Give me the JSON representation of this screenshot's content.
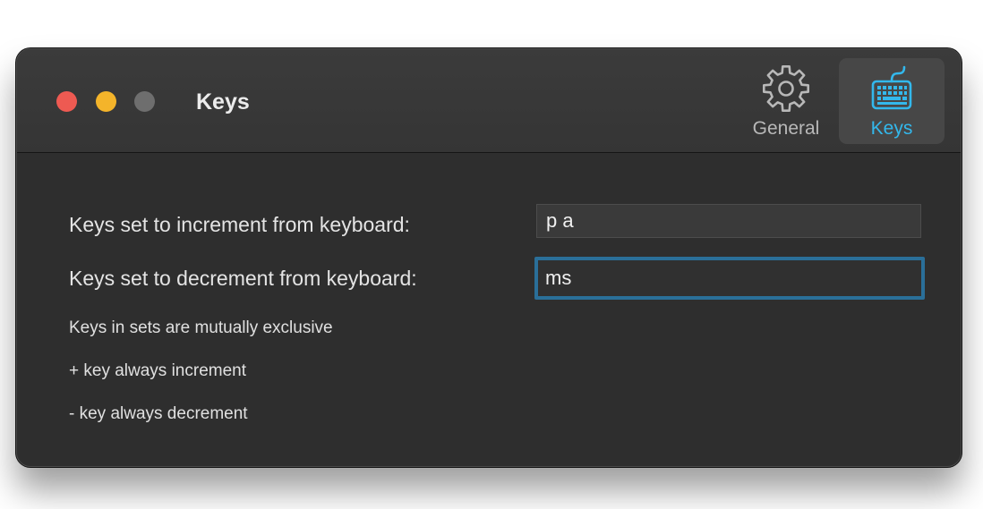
{
  "window": {
    "title": "Keys"
  },
  "traffic_lights": {
    "close_color": "#ee5a52",
    "minimize_color": "#f4b42a",
    "zoom_color": "#6e6e6e"
  },
  "toolbar": {
    "items": [
      {
        "label": "General",
        "icon": "gear-icon",
        "selected": false,
        "color": "#b8b8b8"
      },
      {
        "label": "Keys",
        "icon": "keyboard-icon",
        "selected": true,
        "color": "#33b8ec"
      }
    ]
  },
  "form": {
    "increment_label": "Keys set to increment from keyboard:",
    "increment_value": "p a",
    "decrement_label": "Keys set to decrement from keyboard:",
    "decrement_value": "ms"
  },
  "notes": [
    "Keys in sets are mutually exclusive",
    "+ key always increment",
    "- key always decrement"
  ],
  "colors": {
    "accent": "#33b8ec",
    "focus_ring": "#2a6f99",
    "window_background": "#2e2e2e"
  }
}
